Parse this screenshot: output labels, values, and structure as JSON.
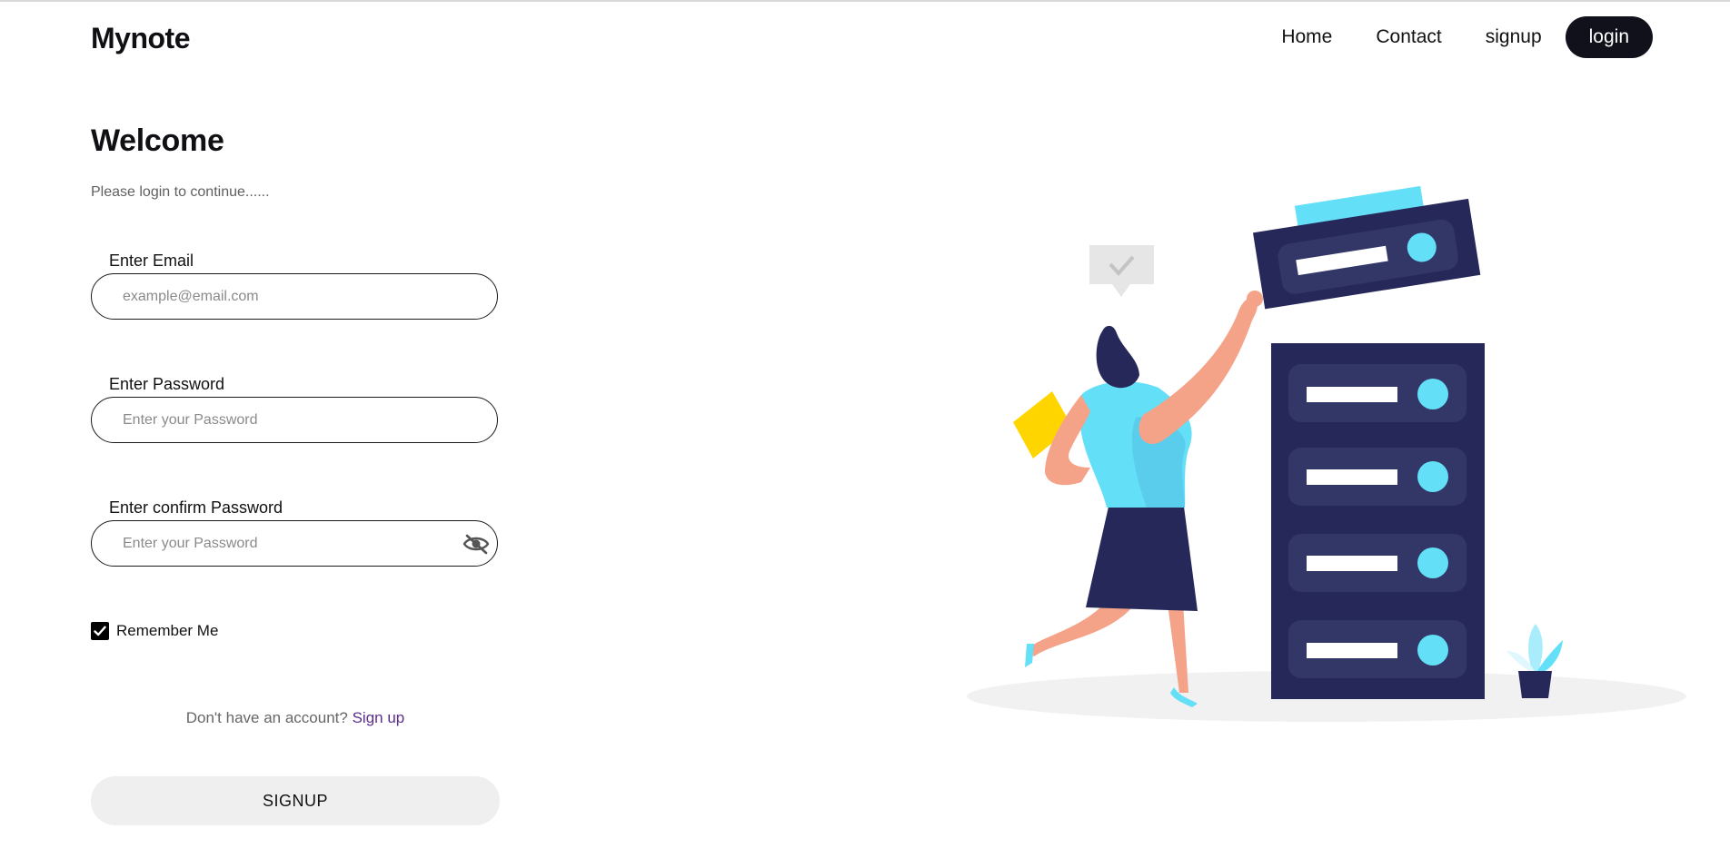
{
  "brand": {
    "name": "Mynote"
  },
  "nav": {
    "items": [
      {
        "label": "Home"
      },
      {
        "label": "Contact"
      },
      {
        "label": "signup"
      }
    ],
    "login_label": "login"
  },
  "main": {
    "heading": "Welcome",
    "subtitle": "Please login to continue......",
    "fields": [
      {
        "label": "Enter Email",
        "placeholder": "example@email.com",
        "value": ""
      },
      {
        "label": "Enter Password",
        "placeholder": "Enter your Password",
        "value": ""
      },
      {
        "label": "Enter confirm Password",
        "placeholder": "Enter your Password",
        "value": ""
      }
    ],
    "remember": {
      "label": "Remember Me",
      "checked": true
    },
    "account_prompt": "Don't have an account?",
    "account_link": "Sign up",
    "submit_label": "SIGNUP"
  },
  "icons": {
    "password_toggle": "eye-slash-icon",
    "remember_check": "checkmark-icon"
  },
  "colors": {
    "primary_dark": "#11111c",
    "link": "#5b2d8e",
    "server_navy": "#26285a",
    "accent_cyan": "#63dff8",
    "skin": "#f4a389",
    "folder_yellow": "#ffd500"
  }
}
